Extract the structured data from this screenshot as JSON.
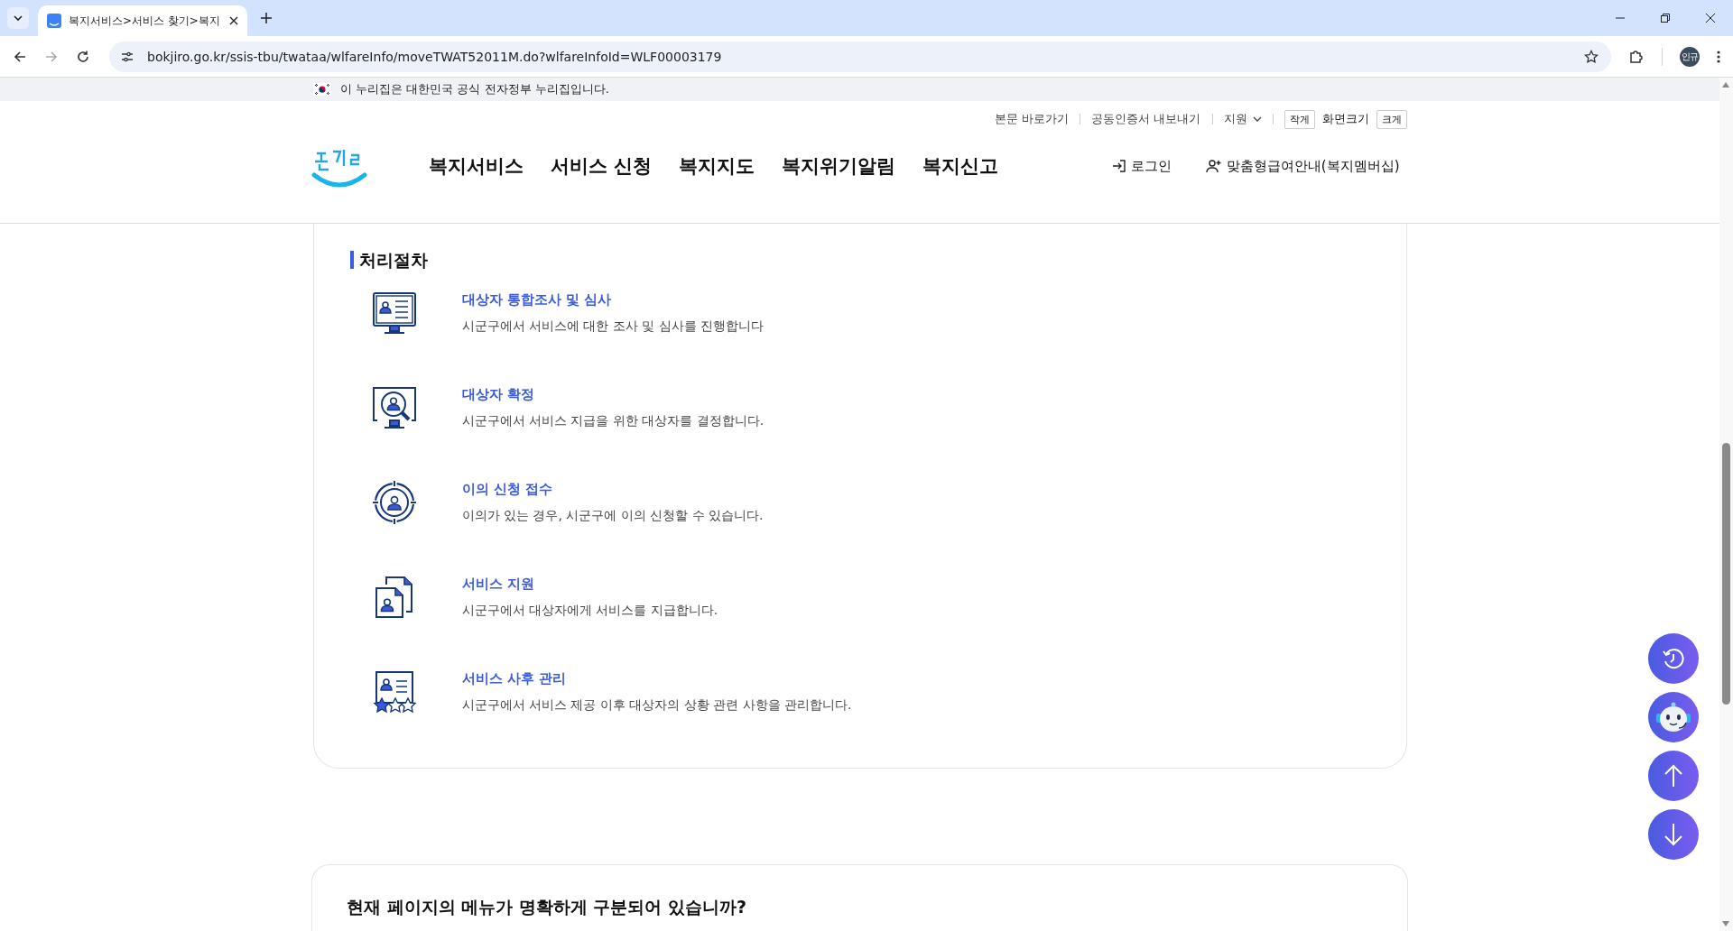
{
  "browser": {
    "tab_title": "복지서비스>서비스 찾기>복지",
    "url": "bokjiro.go.kr/ssis-tbu/twataa/wlfareInfo/moveTWAT52011M.do?wlfareInfoId=WLF00003179",
    "profile": "인규"
  },
  "gov_banner": "이 누리집은 대한민국 공식 전자정부 누리집입니다.",
  "utility_links": [
    {
      "label": "본문 바로가기",
      "kind": "link"
    },
    {
      "label": "공동인증서 내보내기",
      "kind": "link"
    },
    {
      "label": "지원",
      "kind": "dropdown"
    }
  ],
  "font_size": {
    "smaller": "작게",
    "label": "화면크기",
    "larger": "크게"
  },
  "nav": [
    "복지서비스",
    "서비스 신청",
    "복지지도",
    "복지위기알림",
    "복지신고"
  ],
  "account": [
    {
      "label": "로그인",
      "kind": "login"
    },
    {
      "label": "맞춤형급여안내(복지멤버십)",
      "kind": "membership"
    }
  ],
  "section": {
    "title": "처리절차",
    "steps": [
      {
        "kind": "monitor",
        "title": "대상자 통합조사 및 심사",
        "description": "시군구에서 서비스에 대한 조사 및 심사를 진행합니다"
      },
      {
        "kind": "search",
        "title": "대상자 확정",
        "description": "시군구에서 서비스 지급을 위한 대상자를 결정합니다."
      },
      {
        "kind": "target",
        "title": "이의 신청 접수",
        "description": "이의가 있는 경우, 시군구에 이의 신청할 수 있습니다."
      },
      {
        "kind": "document",
        "title": "서비스 지원",
        "description": "시군구에서 대상자에게 서비스를 지급합니다."
      },
      {
        "kind": "rating",
        "title": "서비스 사후 관리",
        "description": "시군구에서 서비스 제공 이후 대상자의 상황 관련 사항을 관리합니다."
      }
    ]
  },
  "survey": {
    "question": "현재 페이지의 메뉴가 명확하게 구분되어 있습니까?"
  }
}
